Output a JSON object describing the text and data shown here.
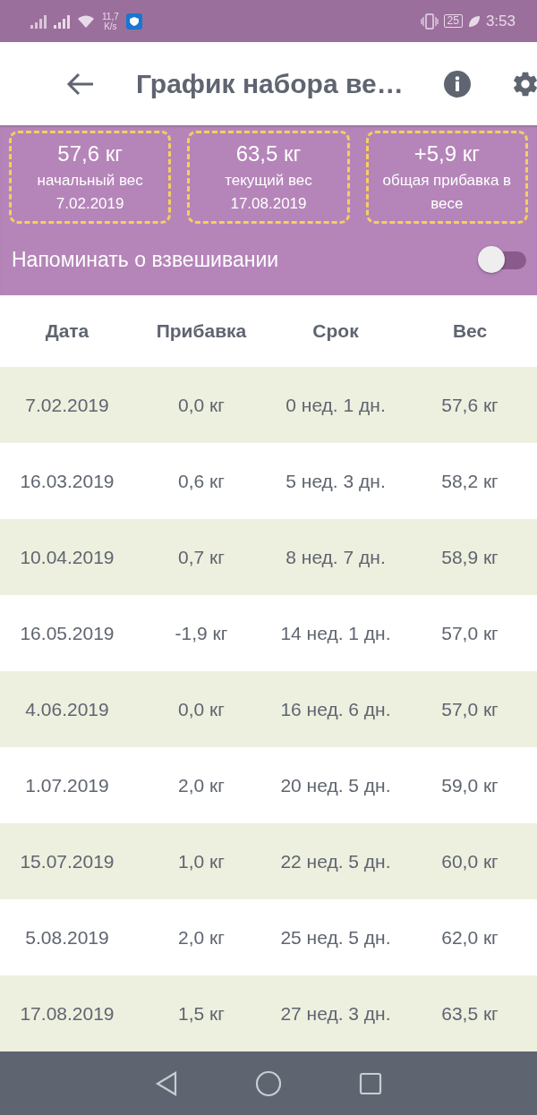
{
  "status_bar": {
    "speed_value": "11,7",
    "speed_unit": "K/s",
    "battery": "25",
    "time": "3:53"
  },
  "app_bar": {
    "title": "График набора ве…"
  },
  "summary": [
    {
      "value": "57,6 кг",
      "label": "начальный вес",
      "sub": "7.02.2019"
    },
    {
      "value": "63,5 кг",
      "label": "текущий вес",
      "sub": "17.08.2019"
    },
    {
      "value": "+5,9 кг",
      "label": "общая прибавка в весе"
    }
  ],
  "reminder": {
    "label": "Напоминать о взвешивании",
    "on": false
  },
  "table": {
    "columns": [
      "Дата",
      "Прибавка",
      "Срок",
      "Вес"
    ],
    "rows": [
      [
        "7.02.2019",
        "0,0 кг",
        "0 нед. 1 дн.",
        "57,6 кг"
      ],
      [
        "16.03.2019",
        "0,6 кг",
        "5 нед. 3 дн.",
        "58,2 кг"
      ],
      [
        "10.04.2019",
        "0,7 кг",
        "8 нед. 7 дн.",
        "58,9 кг"
      ],
      [
        "16.05.2019",
        "-1,9 кг",
        "14 нед. 1 дн.",
        "57,0 кг"
      ],
      [
        "4.06.2019",
        "0,0 кг",
        "16 нед. 6 дн.",
        "57,0 кг"
      ],
      [
        "1.07.2019",
        "2,0 кг",
        "20 нед. 5 дн.",
        "59,0 кг"
      ],
      [
        "15.07.2019",
        "1,0 кг",
        "22 нед. 5 дн.",
        "60,0 кг"
      ],
      [
        "5.08.2019",
        "2,0 кг",
        "25 нед. 5 дн.",
        "62,0 кг"
      ],
      [
        "17.08.2019",
        "1,5 кг",
        "27 нед. 3 дн.",
        "63,5 кг"
      ]
    ]
  }
}
